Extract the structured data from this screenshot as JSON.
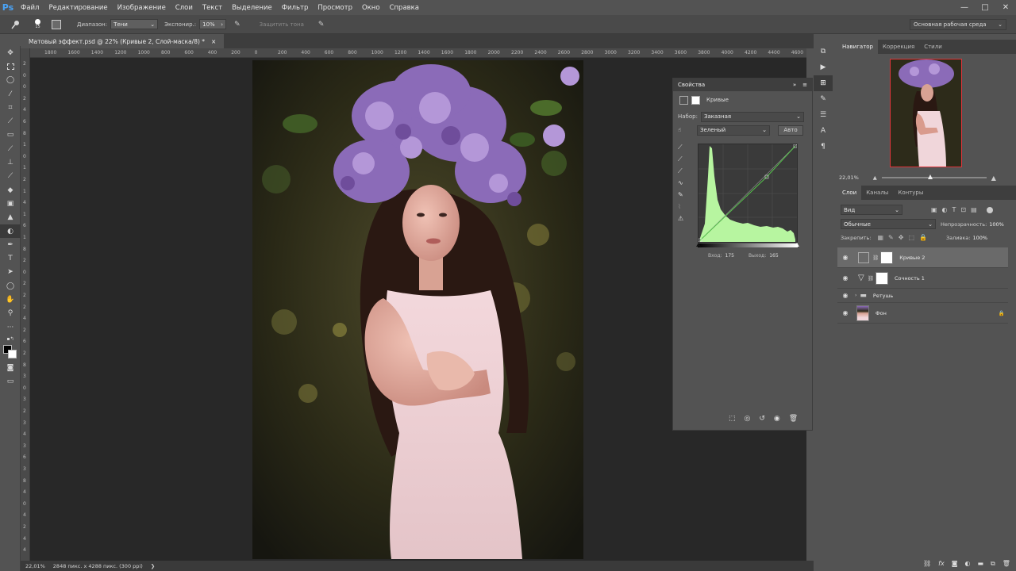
{
  "app": {
    "logo": "Ps"
  },
  "menu": [
    "Файл",
    "Редактирование",
    "Изображение",
    "Слои",
    "Текст",
    "Выделение",
    "Фильтр",
    "Просмотр",
    "Окно",
    "Справка"
  ],
  "window_controls": [
    "—",
    "□",
    "✕"
  ],
  "options": {
    "brush_size": "15",
    "range_label": "Диапазон:",
    "range_value": "Тени",
    "exposure_label": "Экспонир.:",
    "exposure_value": "10%",
    "protect_tones": "Защитить тона",
    "workspace": "Основная рабочая среда"
  },
  "document": {
    "tab_title": "Матовый эффект.psd @ 22% (Кривые 2, Слой-маска/8) *",
    "close": "×"
  },
  "ruler": {
    "h": [
      "1800",
      "1600",
      "1400",
      "1200",
      "1000",
      "800",
      "600",
      "400",
      "200",
      "0",
      "200",
      "400",
      "600",
      "800",
      "1000",
      "1200",
      "1400",
      "1600",
      "1800",
      "2000",
      "2200",
      "2400",
      "2600",
      "2800",
      "3000",
      "3200",
      "3400",
      "3600",
      "3800",
      "4000",
      "4200",
      "4400",
      "4600"
    ],
    "v": [
      "2",
      "0",
      "0",
      "2",
      "4",
      "6",
      "8",
      "1",
      "0",
      "1",
      "2",
      "1",
      "4",
      "1",
      "6",
      "1",
      "8",
      "2",
      "0",
      "2",
      "2",
      "2",
      "4",
      "2",
      "6",
      "2",
      "8",
      "3",
      "0",
      "3",
      "2",
      "3",
      "4",
      "3",
      "6",
      "3",
      "8",
      "4",
      "0",
      "4",
      "2",
      "4",
      "4"
    ]
  },
  "status": {
    "zoom": "22,01%",
    "size": "2848 пикс. x 4288 пикс. (300 ppi)",
    "arrow": "❯"
  },
  "properties": {
    "title": "Свойства",
    "collapse": "»",
    "menu": "≡",
    "adjustment": "Кривые",
    "preset_label": "Набор:",
    "preset_value": "Заказная",
    "channel_value": "Зеленый",
    "auto_button": "Авто",
    "input_label": "Вход:",
    "input_value": "175",
    "output_label": "Выход:",
    "output_value": "165",
    "curve_color": "#55c04a",
    "histogram_color": "#b7f5a0"
  },
  "navigator": {
    "tabs": [
      "Навигатор",
      "Коррекция",
      "Стили"
    ],
    "zoom": "22,01%"
  },
  "layers": {
    "tabs": [
      "Слои",
      "Каналы",
      "Контуры"
    ],
    "filter": "Вид",
    "blend_mode": "Обычные",
    "opacity_label": "Непрозрачность:",
    "opacity_value": "100%",
    "lock_label": "Закрепить:",
    "fill_label": "Заливка:",
    "fill_value": "100%",
    "items": [
      {
        "name": "Кривые 2",
        "kind": "curves-adjustment",
        "selected": true
      },
      {
        "name": "Сочность 1",
        "kind": "vibrance-adjustment",
        "selected": false
      },
      {
        "name": "Ретушь",
        "kind": "group",
        "selected": false
      },
      {
        "name": "Фон",
        "kind": "background",
        "selected": false,
        "locked": true
      }
    ],
    "bottom_icons": [
      "link-icon",
      "fx-icon",
      "mask-icon",
      "adjustment-icon",
      "folder-icon",
      "new-layer-icon",
      "trash-icon"
    ],
    "bottom_labels": {
      "fx": "fx"
    }
  },
  "tools": [
    "move-icon",
    "marquee-icon",
    "lasso-icon",
    "magic-wand-icon",
    "crop-icon",
    "eyedropper-icon",
    "healing-icon",
    "brush-icon",
    "stamp-icon",
    "history-brush-icon",
    "eraser-icon",
    "gradient-icon",
    "blur-icon",
    "dodge-icon",
    "pen-icon",
    "type-icon",
    "path-select-icon",
    "shape-icon",
    "hand-icon",
    "zoom-icon",
    "more-icon"
  ]
}
